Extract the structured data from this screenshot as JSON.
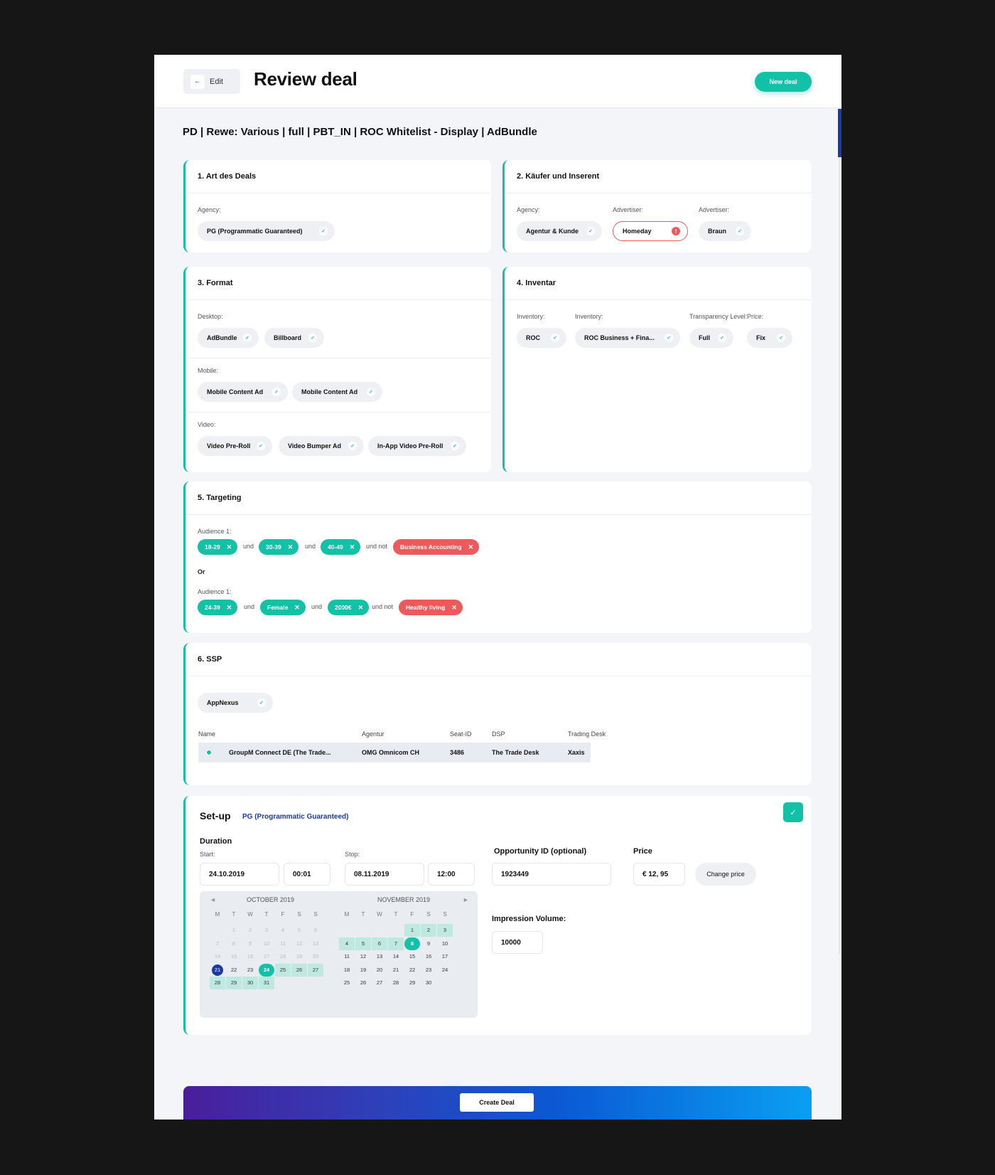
{
  "header": {
    "edit_label": "Edit",
    "title": "Review deal",
    "new_deal_label": "New deal"
  },
  "deal_name": "PD | Rewe: Various | full | PBT_IN | ROC Whitelist - Display | AdBundle",
  "card1": {
    "title": "1. Art des Deals",
    "agency_label": "Agency:",
    "agency_value": "PG (Programmatic Guaranteed)"
  },
  "card2": {
    "title": "2. Käufer und Inserent",
    "agency_label": "Agency:",
    "agency_value": "Agentur & Kunde",
    "advertiser_label": "Advertiser:",
    "advertiser_value": "Homeday",
    "advertiser2_label": "Advertiser:",
    "advertiser2_value": "Braun"
  },
  "card3": {
    "title": "3. Format",
    "desktop_label": "Desktop:",
    "desktop": [
      "AdBundle",
      "Billboard"
    ],
    "mobile_label": "Mobile:",
    "mobile": [
      "Mobile Content Ad",
      "Mobile Content Ad"
    ],
    "video_label": "Video:",
    "video": [
      "Video Pre-Roll",
      "Video Bumper Ad",
      "In-App Video Pre-Roll"
    ]
  },
  "card4": {
    "title": "4. Inventar",
    "inv1_label": "Inventory:",
    "inv1_value": "ROC",
    "inv2_label": "Inventory:",
    "inv2_value": "ROC Business + Fina...",
    "transp_label": "Transparency Level:",
    "transp_value": "Full",
    "price_label": "Price:",
    "price_value": "Fix"
  },
  "card5": {
    "title": "5. Targeting",
    "aud1_label": "Audience 1:",
    "aud1": [
      "18-29",
      "30-39",
      "40-49"
    ],
    "aud1_not": "Business Accounting",
    "or_label": "Or",
    "aud2_label": "Audience 1:",
    "aud2": [
      "24-39",
      "Female",
      "2000€"
    ],
    "aud2_not": "Healthy living",
    "und": "und",
    "und_not": "und not"
  },
  "card6": {
    "title": "6. SSP",
    "ssp_value": "AppNexus",
    "columns": [
      "Name",
      "Agentur",
      "Seat-ID",
      "DSP",
      "Trading Desk"
    ],
    "row": [
      "GroupM Connect DE (The Trade...",
      "OMG Omnicom CH",
      "3486",
      "The Trade Desk",
      "Xaxis"
    ]
  },
  "setup": {
    "title": "Set-up",
    "subtitle": "PG (Programmatic Guaranteed)",
    "duration_label": "Duration",
    "start_label": "Start:",
    "start_date": "24.10.2019",
    "start_time": "00:01",
    "stop_label": "Stop:",
    "stop_date": "08.11.2019",
    "stop_time": "12:00",
    "opp_label": "Opportunity ID (optional)",
    "opp_value": "1923449",
    "price_label": "Price",
    "price_value": "€ 12, 95",
    "change_price_label": "Change price",
    "impr_label": "Impression Volume:",
    "impr_value": "10000",
    "cal_prev": "◄",
    "cal_next": "►",
    "oct_label": "OCTOBER 2019",
    "nov_label": "NOVEMBER 2019",
    "dow": [
      "M",
      "T",
      "W",
      "T",
      "F",
      "S",
      "S"
    ]
  },
  "footer": {
    "create_label": "Create Deal"
  },
  "colors": {
    "accent": "#12c1a6",
    "error": "#ee5a5c",
    "primary": "#1b3aa6"
  },
  "icons": {
    "back": "arrow-left-icon",
    "check": "check-icon",
    "error": "alert-icon",
    "remove": "close-icon"
  }
}
